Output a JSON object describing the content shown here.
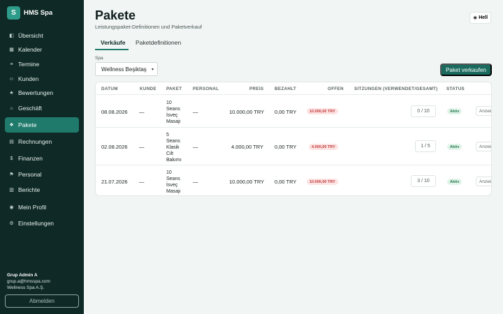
{
  "app": {
    "logo_letter": "S",
    "name": "HMS Spa"
  },
  "sidebar": {
    "items": [
      {
        "label": "Übersicht",
        "icon": "dashboard-icon",
        "glyph": "◧"
      },
      {
        "label": "Kalender",
        "icon": "calendar-icon",
        "glyph": "▦"
      },
      {
        "label": "Termine",
        "icon": "list-icon",
        "glyph": "≡"
      },
      {
        "label": "Kunden",
        "icon": "customers-icon",
        "glyph": "☺"
      },
      {
        "label": "Bewertungen",
        "icon": "star-icon",
        "glyph": "★"
      },
      {
        "label": "Geschäft",
        "icon": "shop-icon",
        "glyph": "⌂"
      },
      {
        "label": "Pakete",
        "icon": "gift-icon",
        "glyph": "❖"
      },
      {
        "label": "Rechnungen",
        "icon": "invoice-icon",
        "glyph": "▤"
      },
      {
        "label": "Finanzen",
        "icon": "money-bag-icon",
        "glyph": "$"
      },
      {
        "label": "Personal",
        "icon": "flag-icon",
        "glyph": "⚑"
      },
      {
        "label": "Berichte",
        "icon": "chart-icon",
        "glyph": "▥"
      },
      {
        "label": "Mein Profil",
        "icon": "user-icon",
        "glyph": "◉"
      },
      {
        "label": "Einstellungen",
        "icon": "gear-icon",
        "glyph": "⚙"
      }
    ],
    "active_index": 6
  },
  "user": {
    "name": "Grup Admin A",
    "email": "grup.a@hmsspa.com",
    "company": "Wellness Spa A.Ş.",
    "logout_label": "Abmelden"
  },
  "header": {
    "title": "Pakete",
    "subtitle": "Leistungspaket-Definitionen und Paketverkauf",
    "theme_label": "Hell",
    "theme_icon": "sun-icon"
  },
  "tabs": [
    {
      "label": "Verkäufe",
      "active": true
    },
    {
      "label": "Paketdefinitionen",
      "active": false
    }
  ],
  "filter": {
    "spa_label": "Spa",
    "spa_value": "Wellness Beşiktaş",
    "sell_button": "Paket verkaufen"
  },
  "table": {
    "headers": [
      "DATUM",
      "KUNDE",
      "PAKET",
      "PERSONAL",
      "PREIS",
      "BEZAHLT",
      "OFFEN",
      "SITZUNGEN (VERWENDET/GESAMT)",
      "STATUS"
    ],
    "rows": [
      {
        "date": "08.08.2026",
        "customer": "—",
        "package": "10 Seans İsveç Masajı",
        "staff": "—",
        "price": "10.000,00 TRY",
        "paid": "0,00 TRY",
        "open": "10.000,00 TRY",
        "sessions": "0 / 10",
        "status": "Aktiv",
        "action": "Anzeigen"
      },
      {
        "date": "02.08.2026",
        "customer": "—",
        "package": "5 Seans Klasik Cilt Bakımı",
        "staff": "—",
        "price": "4.000,00 TRY",
        "paid": "0,00 TRY",
        "open": "4.000,00 TRY",
        "sessions": "1 / 5",
        "status": "Aktiv",
        "action": "Anzeigen"
      },
      {
        "date": "21.07.2026",
        "customer": "—",
        "package": "10 Seans İsveç Masajı",
        "staff": "—",
        "price": "10.000,00 TRY",
        "paid": "0,00 TRY",
        "open": "10.000,00 TRY",
        "sessions": "3 / 10",
        "status": "Aktiv",
        "action": "Anzeigen"
      }
    ]
  },
  "colors": {
    "sidebar_bg": "#0f2a26",
    "accent": "#1f7a6c",
    "primary_button": "#1a6b5e"
  }
}
